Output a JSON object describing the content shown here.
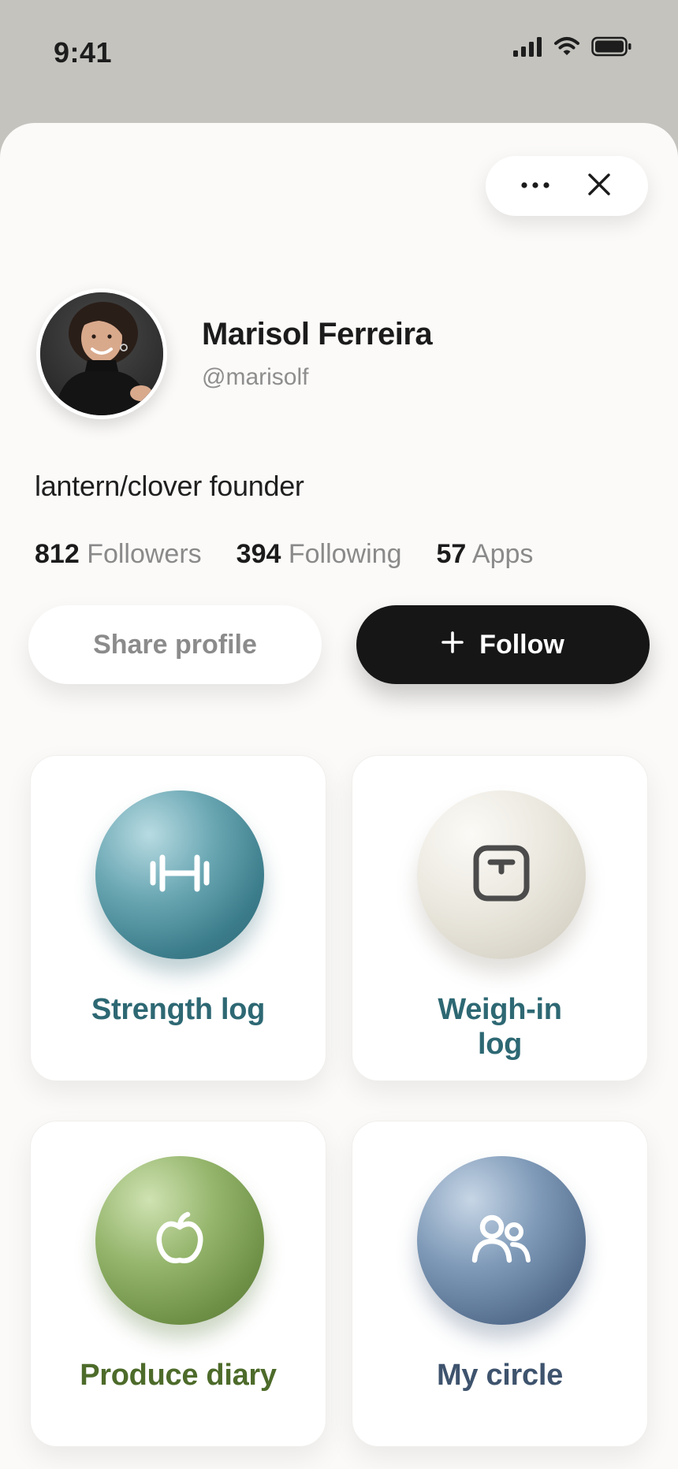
{
  "status_bar": {
    "time": "9:41"
  },
  "profile": {
    "name": "Marisol Ferreira",
    "handle": "@marisolf",
    "bio": "lantern/clover founder"
  },
  "stats": [
    {
      "value": "812",
      "label": "Followers"
    },
    {
      "value": "394",
      "label": "Following"
    },
    {
      "value": "57",
      "label": "Apps"
    }
  ],
  "actions": {
    "share_label": "Share profile",
    "follow_label": "Follow"
  },
  "apps": [
    {
      "title": "Strength log",
      "icon": "dumbbell-icon",
      "color": "#2d6873"
    },
    {
      "title": "Weigh-in log",
      "icon": "scale-icon",
      "color": "#2d6873"
    },
    {
      "title": "Produce diary",
      "icon": "apple-icon",
      "color": "#4d6b2a"
    },
    {
      "title": "My circle",
      "icon": "people-icon",
      "color": "#3e536d"
    }
  ],
  "colors": {
    "follow_button": "#161616",
    "sheet_background": "#fbfaf8",
    "backdrop": "#c4c3be"
  }
}
